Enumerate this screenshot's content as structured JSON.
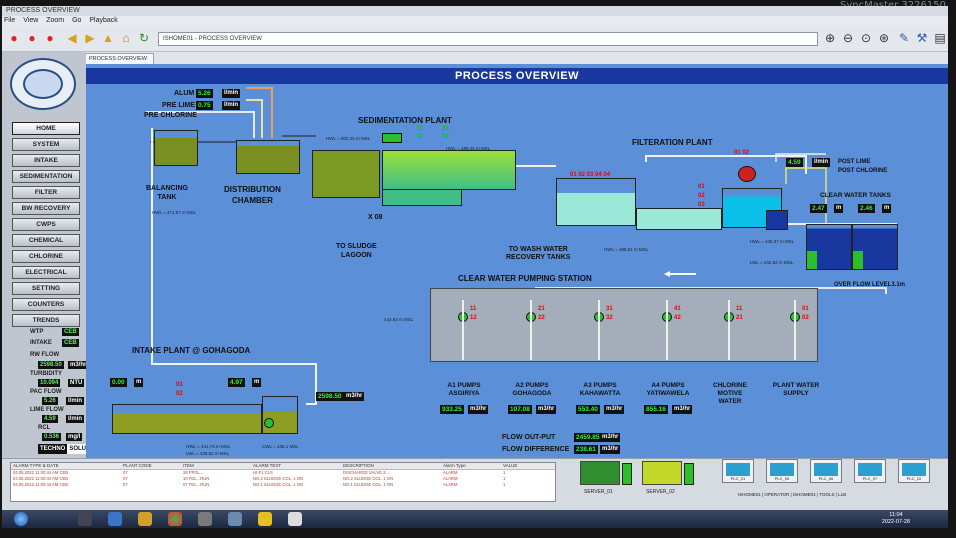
{
  "monitor": {
    "brand": "SyncMaster 3226150"
  },
  "window": {
    "title": "PROCESS OVERVIEW"
  },
  "menu": [
    "File",
    "View",
    "Zoom",
    "Go",
    "Playback"
  ],
  "address": {
    "value": "ISHOME01 - PROCESS OVERVIEW"
  },
  "tab": {
    "label": "PROCESS OVERVIEW"
  },
  "page": {
    "title": "PROCESS OVERVIEW"
  },
  "nav": [
    "HOME",
    "SYSTEM",
    "INTAKE",
    "SEDIMENTATION",
    "FILTER",
    "BW RECOVERY",
    "CWPS",
    "CHEMICAL",
    "CHLORINE",
    "ELECTRICAL",
    "SETTING",
    "COUNTERS",
    "TRENDS"
  ],
  "sidebar": {
    "wtp_label": "WTP",
    "wtp_val": "CEB",
    "intake_label": "INTAKE",
    "intake_val": "CEB",
    "rw_flow_label": "RW FLOW",
    "rw_flow_val": "2598.50",
    "rw_flow_unit": "m3/hr",
    "turbidity_label": "TURBIDITY",
    "turbidity_val": "10.094",
    "turbidity_unit": "NTU",
    "pac_flow_label": "PAC FLOW",
    "pac_flow_val": "5.26",
    "pac_flow_unit": "l/min",
    "lime_flow_label": "LIME FLOW",
    "lime_flow_val": "4.59",
    "lime_flow_unit": "l/min",
    "rcl_label": "RCL",
    "rcl_val": "0.536",
    "rcl_unit": "mg/l",
    "brand": "TECHNO",
    "brand2": "SOLUTIONS"
  },
  "chem": {
    "alum_label": "ALUM",
    "alum_val": "5.26",
    "alum_unit": "l/min",
    "prelime_label": "PRE LIME",
    "prelime_val": "0.75",
    "prelime_unit": "l/min",
    "prechlorine_label": "PRE CHLORINE",
    "postlime_val": "4.59",
    "postlime_unit": "l/min",
    "postlime_label": "POST LIME",
    "postchlorine_label": "POST CHLORINE"
  },
  "sections": {
    "sedimentation": "SEDIMENTATION PLANT",
    "filteration": "FILTERATION PLANT",
    "balancing": "BALANCING\nTANK",
    "distribution": "DISTRIBUTION\nCHAMBER",
    "clear_tanks": "CLEAR WATER TANKS",
    "to_sludge": "TO SLUDGE\nLAGOON",
    "to_wash": "TO WASH WATER\nRECOVERY TANKS",
    "pumping_station": "CLEAR WATER PUMPING STATION",
    "intake_plant": "INTAKE PLANT @ GOHAGODA",
    "overflow": "OVER FLOW LEVEL3.1m",
    "x08": "X 08"
  },
  "small_labels": {
    "hwl_bal": "HWL = 471.57 m MSL",
    "hwl_sed": "HWL = 502.25 m MSL",
    "hwl_sed2": "HWL = 488.45 m MSL",
    "hwl_fil": "HWL = 468.81 m MSL",
    "hwl_cw": "HWL = 446.37 m MSL",
    "lwl_cw": "LWL = 442.82 m MSL",
    "lvl_ps": "442.83 m MSL",
    "hwl_intake": "HWL = 441.74 m MSL",
    "lwl_intake": "LWL = 436.82 m MSL",
    "cwl_intake": "CWL = 436.1 MSL"
  },
  "filter_ids": "01 02 03 04 04",
  "filter_pumps": [
    "01",
    "02",
    "03"
  ],
  "post_pumps": "01 02",
  "clear_tanks": {
    "t1_val": "2.47",
    "t2_val": "2.46",
    "unit": "m"
  },
  "intake": {
    "level1": "0.00",
    "level2": "4.97",
    "unit": "m",
    "flow_val": "2598.50",
    "flow_unit": "m3/hr",
    "pump1": "01",
    "pump2": "02"
  },
  "pumps": [
    {
      "name": "A1 PUMPS\nASGIRIYA",
      "val": "933.25",
      "unit": "m3/hr",
      "n1": "11",
      "n2": "12"
    },
    {
      "name": "A2 PUMPS\nGOHAGODA",
      "val": "107.08",
      "unit": "m3/hr",
      "n1": "21",
      "n2": "22"
    },
    {
      "name": "A3 PUMPS\nKAHAWATTA",
      "val": "553.40",
      "unit": "m3/hr",
      "n1": "31",
      "n2": "32"
    },
    {
      "name": "A4 PUMPS\nYATIWAWELA",
      "val": "855.16",
      "unit": "m3/hr",
      "n1": "41",
      "n2": "42"
    },
    {
      "name": "CHLORINE\nMOTIVE\nWATER",
      "val": "",
      "unit": "",
      "n1": "11",
      "n2": "21"
    },
    {
      "name": "PLANT WATER\nSUPPLY",
      "val": "",
      "unit": "",
      "n1": "01",
      "n2": "02"
    }
  ],
  "flow": {
    "out_label": "FLOW OUT-PUT",
    "out_val": "2459.85",
    "out_unit": "m3/hr",
    "diff_label": "FLOW DIFFERENCE",
    "diff_val": "238.61",
    "diff_unit": "m3/hr"
  },
  "sed_pumps": [
    "11",
    "12",
    "21",
    "22"
  ],
  "alarm": {
    "headers": [
      "ALARM TYPE & DATE",
      "PLANT CODE",
      "ITEM",
      "ALARM TEXT",
      "DESCRIPTION",
      "Alarm Type",
      "VALUE"
    ],
    "rows": [
      [
        "04.05.2022 11:00:44 AM CEB",
        "07",
        "28 PFOL...",
        "HI-F1 CLS",
        "DISCHARGE VALVE 3 ...",
        "ALARM",
        "1"
      ],
      [
        "04.05.2022 11:00:44 AM CEB",
        "07",
        "10 FDL...RUN",
        "NO.2 SLUDGE COL. 1 ON",
        "NO.2 SLUDGE COL. 1 ON",
        "ALARM",
        "1"
      ],
      [
        "04.05.2022 11:00:44 AM CEB",
        "07",
        "07 FDL...RUN",
        "NO.1 SLUDGE COL. 1 ON",
        "NO.1 SLUDGE COL. 1 ON",
        "ALARM",
        "1"
      ]
    ]
  },
  "servers": {
    "s1": "SERVER_01",
    "s2": "SERVER_02"
  },
  "plcs": [
    "PLC_01",
    "PLC_05",
    "PLC_06",
    "PLC_07",
    "PLC_10"
  ],
  "status_path": "ISHOME01 | OPERATOR | ISHOME01 | TOOLS | LLB",
  "clock": {
    "time": "11:04",
    "date": "2022-07-28"
  }
}
